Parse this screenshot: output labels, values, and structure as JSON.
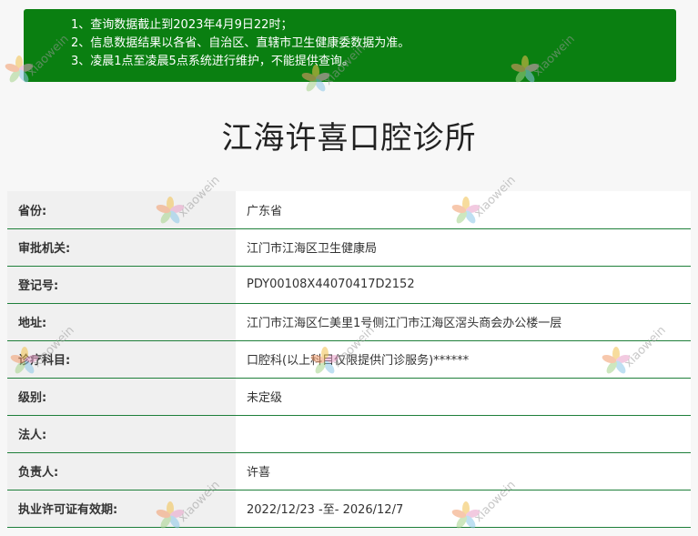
{
  "notice": {
    "lines": [
      "1、查询数据截止到2023年4月9日22时；",
      "2、信息数据结果以各省、自治区、直辖市卫生健康委数据为准。",
      "3、凌晨1点至凌晨5点系统进行维护，不能提供查询。"
    ],
    "background_color": "#0a7f11"
  },
  "clinic": {
    "name": "江海许喜口腔诊所"
  },
  "fields": [
    {
      "label": "省份:",
      "value": "广东省"
    },
    {
      "label": "审批机关:",
      "value": "江门市江海区卫生健康局"
    },
    {
      "label": "登记号:",
      "value": "PDY00108X44070417D2152"
    },
    {
      "label": "地址:",
      "value": "江门市江海区仁美里1号侧江门市江海区滘头商会办公楼一层"
    },
    {
      "label": "诊疗科目:",
      "value": "口腔科(以上科目仅限提供门诊服务)******"
    },
    {
      "label": "级别:",
      "value": "未定级"
    },
    {
      "label": "法人:",
      "value": ""
    },
    {
      "label": "负责人:",
      "value": "许喜"
    },
    {
      "label": "执业许可证有效期:",
      "value": "2022/12/23 -至- 2026/12/7"
    }
  ],
  "watermark": {
    "text": "xiaowein",
    "icon": "flower-logo-icon"
  },
  "colors": {
    "row_border": "#1e7f3a",
    "label_bg": "#f0f0f0"
  }
}
